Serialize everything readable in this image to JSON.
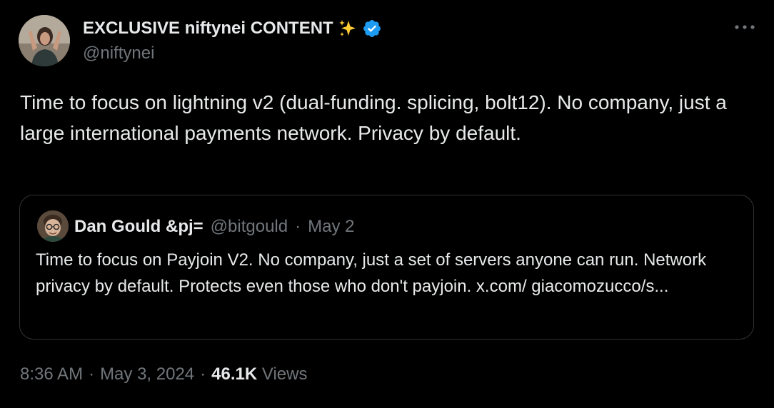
{
  "author": {
    "name": "EXCLUSIVE niftynei CONTENT",
    "emoji": "✨",
    "handle": "@niftynei",
    "verified": true
  },
  "tweet": {
    "text": "Time to focus on lightning v2 (dual-funding. splicing, bolt12). No company, just a large international payments network. Privacy by default."
  },
  "quote": {
    "name": "Dan Gould &pj=",
    "handle": "@bitgould",
    "separator": "·",
    "date": "May 2",
    "text": "Time to focus on Payjoin V2. No company, just a set of servers anyone can run. Network privacy by default. Protects even those who don't payjoin. x.com/ giacomozucco/s..."
  },
  "meta": {
    "time": "8:36 AM",
    "dot1": "·",
    "date": "May 3, 2024",
    "dot2": "·",
    "views_count": "46.1K",
    "views_label": "Views"
  },
  "colors": {
    "background": "#000000",
    "text": "#e7e9ea",
    "muted": "#71767b",
    "border": "#2f3336",
    "verified": "#1d9bf0",
    "sparkle": "#ffcc33"
  },
  "icons": {
    "verified": "verified-badge-icon",
    "more": "more-horizontal-icon"
  }
}
